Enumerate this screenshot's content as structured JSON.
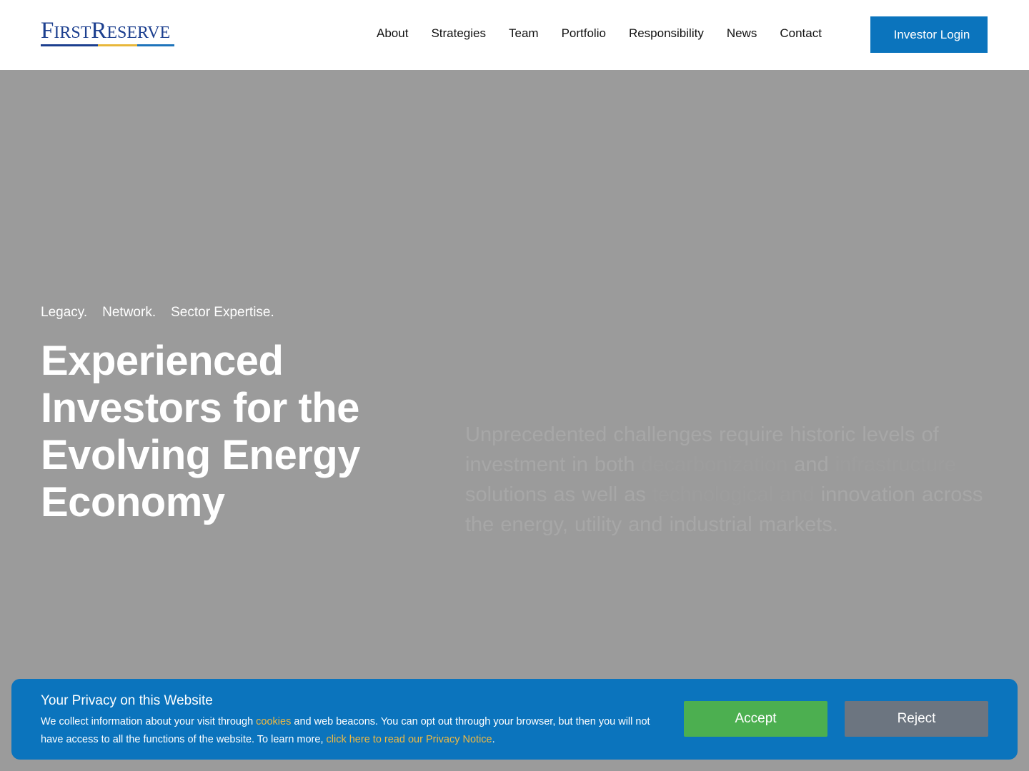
{
  "header": {
    "logo": {
      "part1_big": "F",
      "part1_small": "IRST",
      "part2_big": "R",
      "part2_small": "ESERVE"
    },
    "nav": [
      "About",
      "Strategies",
      "Team",
      "Portfolio",
      "Responsibility",
      "News",
      "Contact"
    ],
    "login_label": "Investor Login"
  },
  "hero": {
    "tagline": [
      "Legacy.",
      "Network.",
      "Sector Expertise."
    ],
    "title": "Experienced Investors for the Evolving Energy Economy",
    "description": {
      "part1": "Unprecedented challenges require historic levels of investment in both",
      "gap1": "decarbonization",
      "part2": "and",
      "gap2": "infrastructure",
      "part3": "solutions as well as",
      "gap3": "technological and",
      "part4": "innovation across the energy, utility and industrial markets."
    }
  },
  "cookie": {
    "title": "Your Privacy on this Website",
    "text1": "We collect information about your visit through",
    "link1": "cookies",
    "text2": "and web beacons. You can opt out through your browser, but then you will not have access to all the functions of the website. To learn more,",
    "link2": "click here to read our Privacy Notice",
    "text3": ".",
    "accept_label": "Accept",
    "reject_label": "Reject"
  },
  "colors": {
    "brand_navy": "#1c3f8f",
    "brand_gold": "#e8b73a",
    "brand_blue": "#0b74bd",
    "accept_green": "#4caf50",
    "reject_gray": "#6c7580",
    "overlay_gray": "#9b9b9b"
  }
}
